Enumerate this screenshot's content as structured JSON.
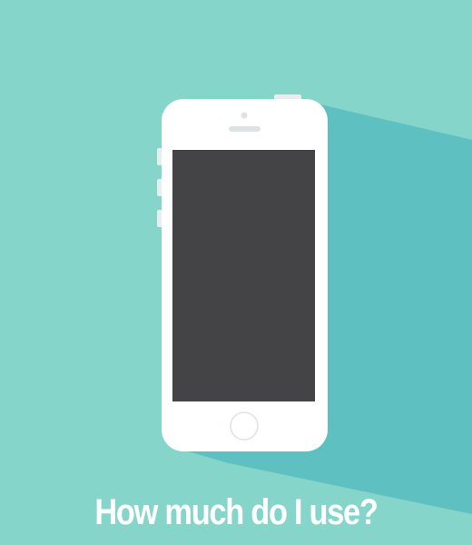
{
  "colors": {
    "background": "#86D5CA",
    "long_shadow": "#5FC0C1",
    "phone_body": "#FFFFFF",
    "phone_buttons": "#E7EEEE",
    "screen": "#444446",
    "speaker": "#DDE3E3",
    "home_button_ring": "#DDE3E3",
    "caption_text": "#FFFFFF"
  },
  "illustration": {
    "subject": "smartphone-flat-illustration"
  },
  "caption": {
    "text": "How much do I use?"
  }
}
